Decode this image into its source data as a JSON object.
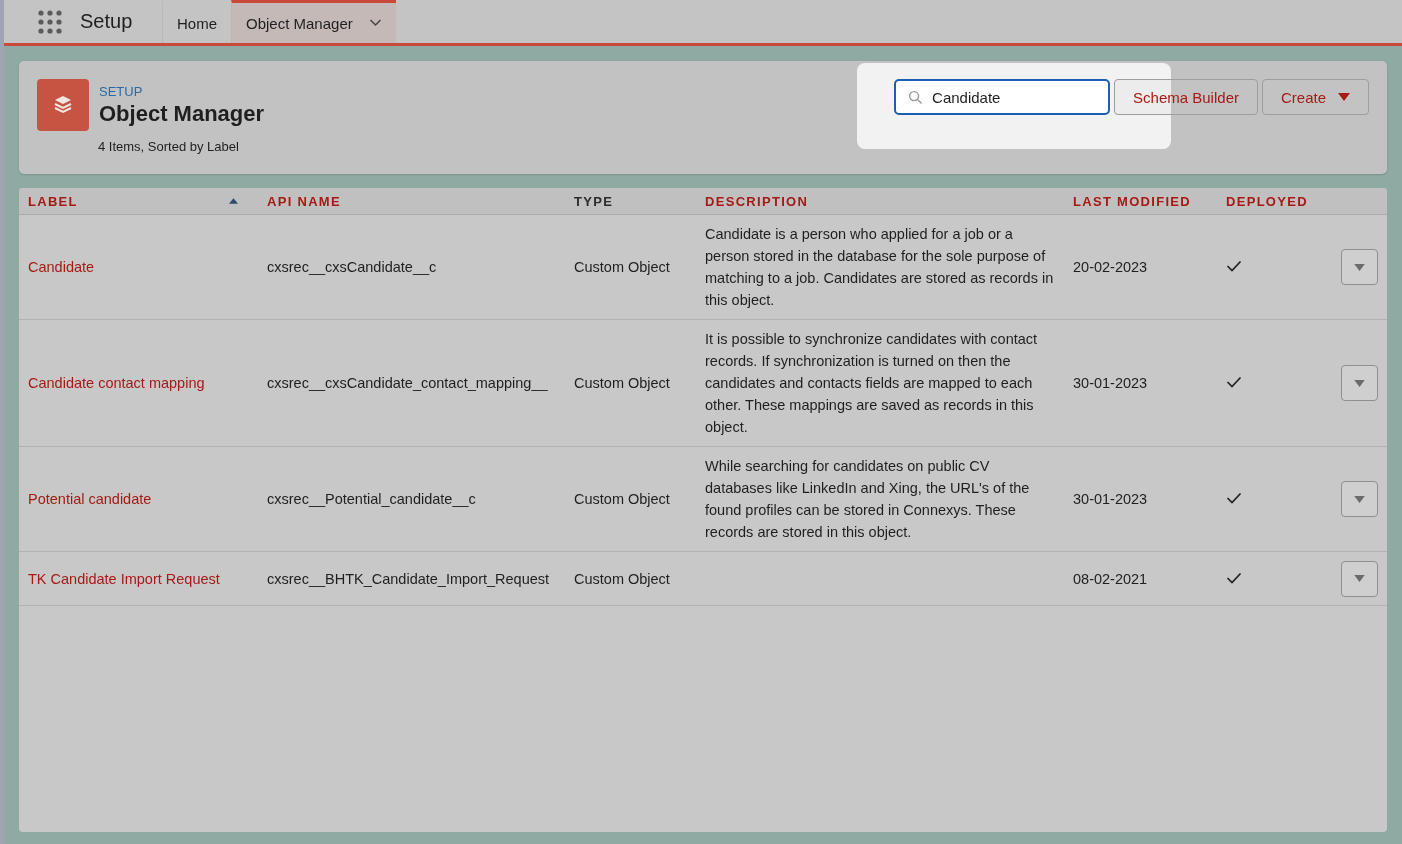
{
  "app": {
    "title": "Setup"
  },
  "tabs": [
    {
      "label": "Home",
      "selected": false,
      "has_menu": false
    },
    {
      "label": "Object Manager",
      "selected": true,
      "has_menu": true
    }
  ],
  "header": {
    "eyebrow": "SETUP",
    "title": "Object Manager",
    "summary": "4 Items, Sorted by Label"
  },
  "search": {
    "value": "Candidate"
  },
  "buttons": [
    {
      "label": "Schema Builder",
      "kind": "plain"
    },
    {
      "label": "Create",
      "kind": "menu"
    }
  ],
  "table": {
    "columns": [
      {
        "label": "LABEL",
        "sorted": true,
        "color": "#a61a14"
      },
      {
        "label": "API NAME",
        "sorted": false,
        "color": "#a61a14"
      },
      {
        "label": "TYPE",
        "sorted": false,
        "color": "#2b2b2b"
      },
      {
        "label": "DESCRIPTION",
        "sorted": false,
        "color": "#a61a14"
      },
      {
        "label": "LAST MODIFIED",
        "sorted": false,
        "color": "#a61a14"
      },
      {
        "label": "DEPLOYED",
        "sorted": false,
        "color": "#a61a14"
      }
    ],
    "rows": [
      {
        "label": "Candidate",
        "api_name": "cxsrec__cxsCandidate__c",
        "type": "Custom Object",
        "description": "Candidate is a person who applied for a job or a person stored in the database for the sole purpose of matching to a job. Candidates are stored as records in this object.",
        "last_modified": "20-02-2023",
        "deployed": true
      },
      {
        "label": "Candidate contact mapping",
        "api_name": "cxsrec__cxsCandidate_contact_mapping__",
        "type": "Custom Object",
        "description": "It is possible to synchronize candidates with contact records. If synchronization is turned on then the candidates and contacts fields are mapped to each other. These mappings are saved as records in this object.",
        "last_modified": "30-01-2023",
        "deployed": true
      },
      {
        "label": "Potential candidate",
        "api_name": "cxsrec__Potential_candidate__c",
        "type": "Custom Object",
        "description": "While searching for candidates on public CV databases like LinkedIn and Xing, the URL's of the found profiles can be stored in Connexys. These records are stored in this object.",
        "last_modified": "30-01-2023",
        "deployed": true
      },
      {
        "label": "TK Candidate Import Request",
        "api_name": "cxsrec__BHTK_Candidate_Import_Request",
        "type": "Custom Object",
        "description": "",
        "last_modified": "08-02-2021",
        "deployed": true
      }
    ]
  }
}
